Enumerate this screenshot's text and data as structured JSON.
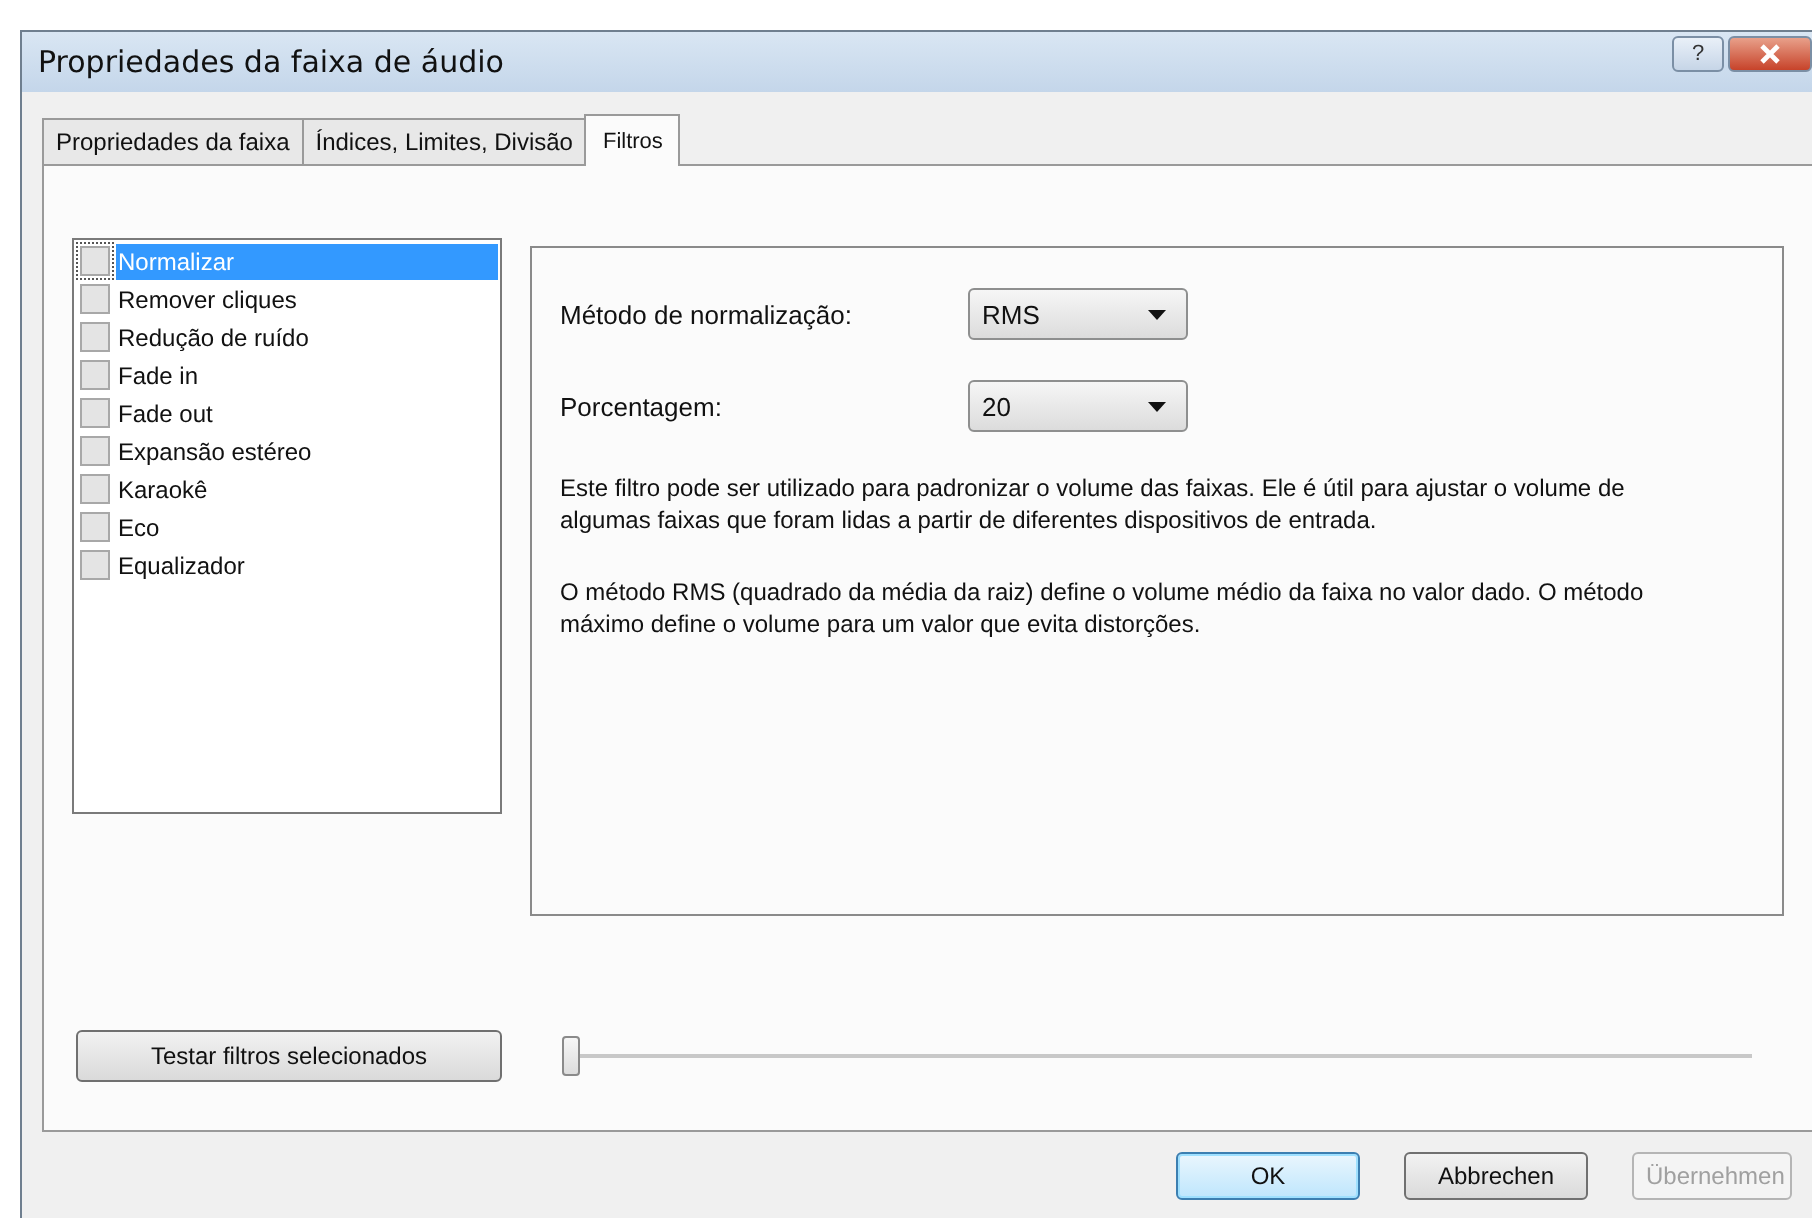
{
  "window": {
    "title": "Propriedades da faixa de áudio",
    "help_button": "?"
  },
  "tabs": [
    {
      "label": "Propriedades da faixa",
      "selected": false
    },
    {
      "label": "Índices, Limites, Divisão",
      "selected": false
    },
    {
      "label": "Filtros",
      "selected": true
    }
  ],
  "filters": [
    {
      "label": "Normalizar",
      "checked": false,
      "selected": true
    },
    {
      "label": "Remover cliques",
      "checked": false,
      "selected": false
    },
    {
      "label": "Redução de ruído",
      "checked": false,
      "selected": false
    },
    {
      "label": "Fade in",
      "checked": false,
      "selected": false
    },
    {
      "label": "Fade out",
      "checked": false,
      "selected": false
    },
    {
      "label": "Expansão estéreo",
      "checked": false,
      "selected": false
    },
    {
      "label": "Karaokê",
      "checked": false,
      "selected": false
    },
    {
      "label": "Eco",
      "checked": false,
      "selected": false
    },
    {
      "label": "Equalizador",
      "checked": false,
      "selected": false
    }
  ],
  "settings": [
    {
      "label": "Método de normalização:",
      "value": "RMS"
    },
    {
      "label": "Porcentagem:",
      "value": "20"
    }
  ],
  "description": [
    "Este filtro pode ser utilizado para padronizar o volume das faixas. Ele é útil para ajustar o volume de algumas faixas que foram lidas a partir de diferentes dispositivos de entrada.",
    "O método RMS (quadrado da média da raiz) define o volume médio da faixa no valor dado. O método máximo define o volume para um valor que evita distorções."
  ],
  "test_button": "Testar filtros selecionados",
  "preview_slider": {
    "level": 0
  },
  "buttons": [
    {
      "label": "OK",
      "default": true,
      "disabled": false
    },
    {
      "label": "Abbrechen",
      "default": false,
      "disabled": false
    },
    {
      "label": "Übernehmen",
      "default": false,
      "disabled": true
    }
  ]
}
